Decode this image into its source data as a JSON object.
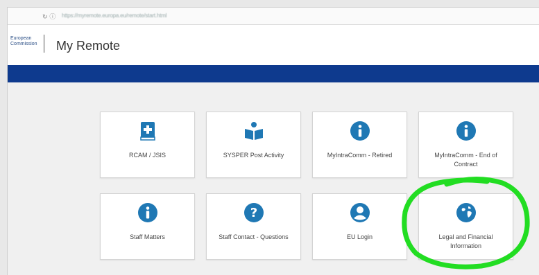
{
  "browser": {
    "url": "https://myremote.europa.eu/remote/start.html"
  },
  "header": {
    "logo_line1": "European",
    "logo_line2": "Commission",
    "app_title": "My Remote"
  },
  "colors": {
    "accent": "#0e3a8e",
    "icon": "#1f78b4",
    "highlight": "#22dd22"
  },
  "tiles": [
    {
      "label": "RCAM / JSIS",
      "icon": "medical-book-icon"
    },
    {
      "label": "SYSPER Post Activity",
      "icon": "open-book-reader-icon"
    },
    {
      "label": "MyIntraComm - Retired",
      "icon": "info-icon"
    },
    {
      "label": "MyIntraComm - End of Contract",
      "icon": "info-icon"
    },
    {
      "label": "Staff Matters",
      "icon": "info-icon"
    },
    {
      "label": "Staff Contact - Questions",
      "icon": "question-icon"
    },
    {
      "label": "EU Login",
      "icon": "user-icon"
    },
    {
      "label": "Legal and Financial Information",
      "icon": "globe-icon"
    }
  ]
}
